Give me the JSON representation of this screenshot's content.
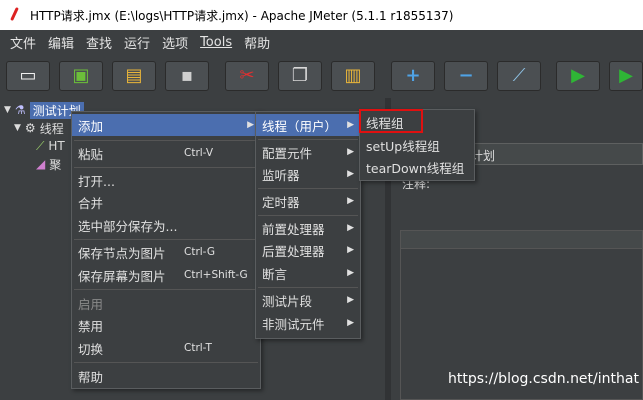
{
  "window": {
    "title": "HTTP请求.jmx (E:\\logs\\HTTP请求.jmx) - Apache JMeter (5.1.1 r1855137)"
  },
  "menubar": [
    "文件",
    "编辑",
    "查找",
    "运行",
    "选项",
    "Tools",
    "帮助"
  ],
  "toolbar": {
    "buttons": [
      {
        "name": "new-icon",
        "glyph": "▭"
      },
      {
        "name": "templates-icon",
        "glyph": "▣"
      },
      {
        "name": "open-icon",
        "glyph": "▤"
      },
      {
        "name": "save-icon",
        "glyph": "▪"
      },
      {
        "name": "cut-icon",
        "glyph": "✂"
      },
      {
        "name": "copy-icon",
        "glyph": "❐"
      },
      {
        "name": "paste-icon",
        "glyph": "▥"
      },
      {
        "name": "expand-icon",
        "glyph": "+"
      },
      {
        "name": "collapse-icon",
        "glyph": "−"
      },
      {
        "name": "toggle-icon",
        "glyph": "⟋"
      },
      {
        "name": "start-icon",
        "glyph": "▶"
      },
      {
        "name": "start-no-pause-icon",
        "glyph": "▶"
      }
    ],
    "colors": {
      "start": "#2fb536",
      "plusminus": "#4fa3e6",
      "cut": "#e03030"
    }
  },
  "tree": {
    "root_label": "测试计划",
    "thread_group_label": "线程",
    "http_label": "HT",
    "listener_label": "聚"
  },
  "rightpane": {
    "name_value": "计划",
    "comment_label": "注释:"
  },
  "context_menu": {
    "items": [
      {
        "label": "添加",
        "shortcut": "",
        "submenu": true,
        "active": true
      },
      {
        "label": "粘贴",
        "shortcut": "Ctrl-V"
      },
      {
        "label": "打开..."
      },
      {
        "label": "合并"
      },
      {
        "label": "选中部分保存为..."
      },
      {
        "label": "保存节点为图片",
        "shortcut": "Ctrl-G"
      },
      {
        "label": "保存屏幕为图片",
        "shortcut": "Ctrl+Shift-G"
      },
      {
        "label": "启用",
        "disabled": true
      },
      {
        "label": "禁用"
      },
      {
        "label": "切换",
        "shortcut": "Ctrl-T"
      },
      {
        "label": "帮助"
      }
    ]
  },
  "add_submenu": {
    "items": [
      {
        "label": "线程（用户）",
        "active": true
      },
      {
        "label": "配置元件"
      },
      {
        "label": "监听器"
      },
      {
        "label": "定时器"
      },
      {
        "label": "前置处理器"
      },
      {
        "label": "后置处理器"
      },
      {
        "label": "断言"
      },
      {
        "label": "测试片段"
      },
      {
        "label": "非测试元件"
      }
    ]
  },
  "threads_submenu": {
    "items": [
      {
        "label": "线程组"
      },
      {
        "label": "setUp线程组"
      },
      {
        "label": "tearDown线程组"
      }
    ]
  },
  "watermark": "https://blog.csdn.net/inthat"
}
